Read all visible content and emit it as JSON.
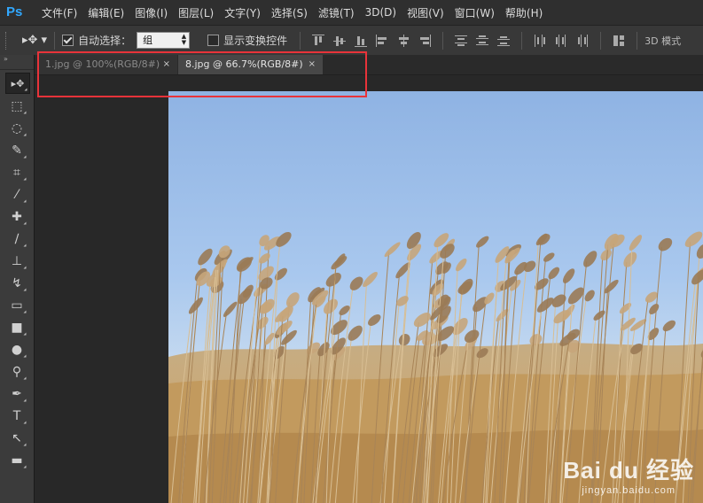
{
  "app": {
    "logo": "Ps"
  },
  "menu": [
    "文件(F)",
    "编辑(E)",
    "图像(I)",
    "图层(L)",
    "文字(Y)",
    "选择(S)",
    "滤镜(T)",
    "3D(D)",
    "视图(V)",
    "窗口(W)",
    "帮助(H)"
  ],
  "options": {
    "auto_select_label": "自动选择：",
    "auto_select_checked": true,
    "auto_select_value": "组",
    "show_transform_label": "显示变换控件",
    "show_transform_checked": false,
    "mode_3d_label": "3D 模式"
  },
  "tabs": [
    {
      "label": "1.jpg @ 100%(RGB/8#)",
      "close": "×",
      "active": false
    },
    {
      "label": "8.jpg @ 66.7%(RGB/8#)",
      "close": "×",
      "active": true
    }
  ],
  "tools": [
    "move-tool",
    "marquee-tool",
    "lasso-tool",
    "quick-select-tool",
    "crop-tool",
    "eyedropper-tool",
    "healing-brush-tool",
    "brush-tool",
    "clone-stamp-tool",
    "history-brush-tool",
    "eraser-tool",
    "gradient-tool",
    "blur-tool",
    "dodge-tool",
    "pen-tool",
    "type-tool",
    "path-select-tool",
    "shape-tool"
  ],
  "tool_glyphs": [
    "▸✥",
    "⬚",
    "◌",
    "✎",
    "⌗",
    "⁄",
    "✚",
    "∕",
    "⊥",
    "↯",
    "▭",
    "■",
    "●",
    "⚲",
    "✒",
    "T",
    "↖",
    "▬"
  ],
  "watermark": {
    "brand": "Bai du 经验",
    "sub": "jingyan.baidu.com"
  },
  "colors": {
    "highlight": "#e8333a",
    "logo": "#31a8ff"
  }
}
